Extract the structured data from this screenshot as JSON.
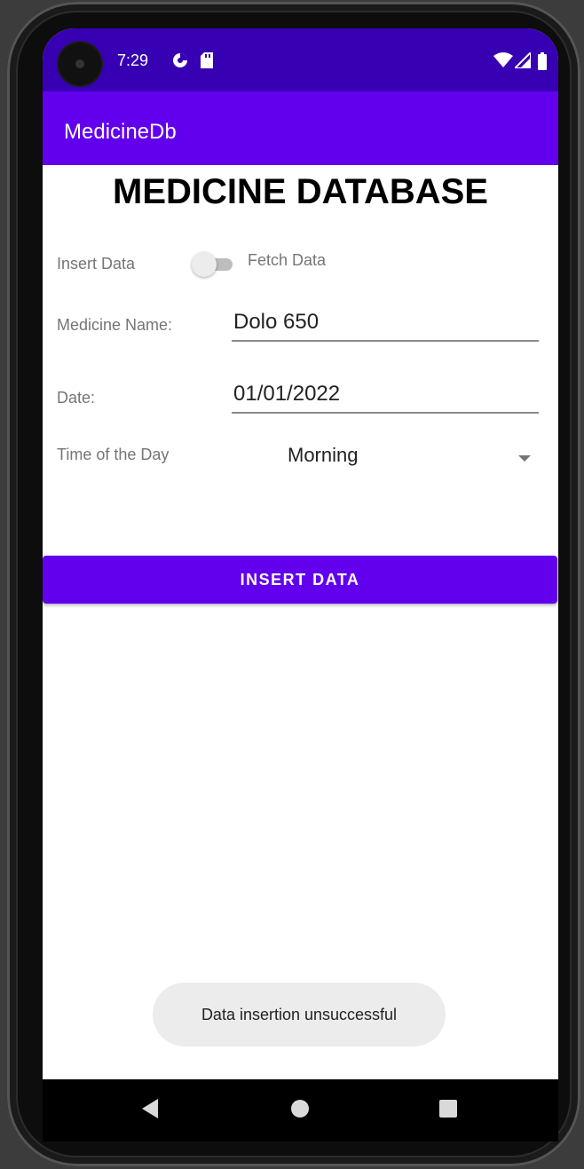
{
  "status_bar": {
    "time": "7:29",
    "icons": [
      "data-saver-icon",
      "sd-card-icon",
      "wifi-icon",
      "signal-icon",
      "battery-icon"
    ]
  },
  "app_bar": {
    "title": "MedicineDb"
  },
  "heading": "MEDICINE DATABASE",
  "mode_toggle": {
    "left_label": "Insert Data",
    "right_label": "Fetch Data",
    "checked": false
  },
  "form": {
    "medicine_name_label": "Medicine Name:",
    "medicine_name_value": "Dolo 650",
    "date_label": "Date:",
    "date_value": "01/01/2022",
    "time_of_day_label": "Time of the Day",
    "time_of_day_value": "Morning"
  },
  "insert_button_label": "INSERT DATA",
  "toast": "Data insertion unsuccessful",
  "nav_bar": {
    "icons": [
      "back-icon",
      "home-icon",
      "recents-icon"
    ]
  },
  "colors": {
    "primary": "#6200ee",
    "primary_dark": "#3700b3",
    "toast_bg": "#ececec"
  }
}
